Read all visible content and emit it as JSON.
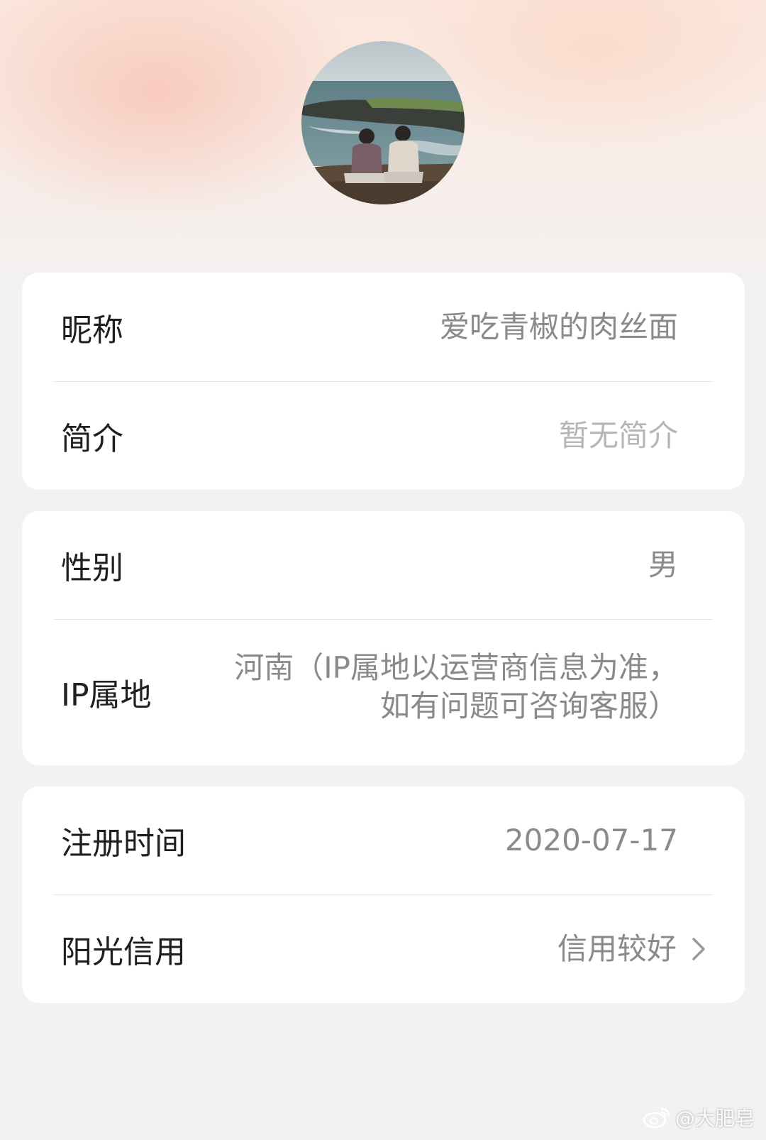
{
  "profile": {
    "nickname_label": "昵称",
    "nickname_value": "爱吃青椒的肉丝面",
    "bio_label": "简介",
    "bio_value": "暂无简介",
    "gender_label": "性别",
    "gender_value": "男",
    "ip_label": "IP属地",
    "ip_value_line1": "河南（IP属地以运营商信息为准，",
    "ip_value_line2": "如有问题可咨询客服）",
    "register_label": "注册时间",
    "register_value": "2020-07-17",
    "credit_label": "阳光信用",
    "credit_value": "信用较好"
  },
  "icons": {
    "avatar": "avatar-photo",
    "chevron": "chevron-right-icon",
    "watermark": "weibo-icon"
  },
  "watermark": {
    "text": "@大肥皂"
  }
}
